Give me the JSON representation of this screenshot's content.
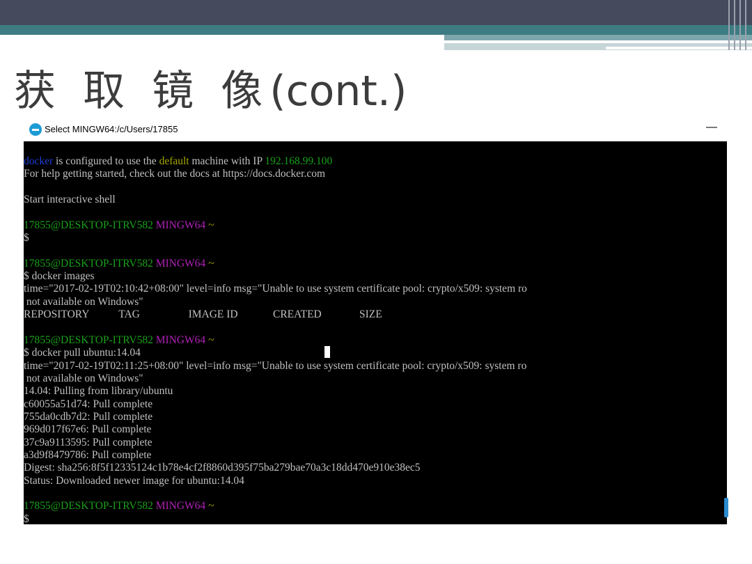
{
  "slide": {
    "title_cjk": "获 取 镜 像",
    "title_latin": "(cont.)"
  },
  "window": {
    "title": "Select MINGW64:/c/Users/17855",
    "minimize_glyph": "—"
  },
  "terminal": {
    "line1": {
      "a": "docker",
      "b": " is configured to use the ",
      "c": "default",
      "d": " machine with IP ",
      "e": "192.168.99.100"
    },
    "line2": "For help getting started, check out the docs at https://docs.docker.com",
    "line3": "",
    "line4": "Start interactive shell",
    "line5": "",
    "prompt_user": "17855@DESKTOP-ITRV582",
    "prompt_env": "MINGW64",
    "prompt_path": "~",
    "dollar": "$",
    "cmd_images": "$ docker images",
    "warn1": "time=\"2017-02-19T02:10:42+08:00\" level=info msg=\"Unable to use system certificate pool: crypto/x509: system ro",
    "warn_cont": " not available on Windows\"",
    "images_header": "REPOSITORY           TAG                  IMAGE ID             CREATED              SIZE",
    "cmd_pull": "$ docker pull ubuntu:14.04",
    "warn2": "time=\"2017-02-19T02:11:25+08:00\" level=info msg=\"Unable to use system certificate pool: crypto/x509: system ro",
    "pulling": "14.04: Pulling from library/ubuntu",
    "layers": [
      "c60055a51d74: Pull complete",
      "755da0cdb7d2: Pull complete",
      "969d017f67e6: Pull complete",
      "37c9a9113595: Pull complete",
      "a3d9f8479786: Pull complete"
    ],
    "digest": "Digest: sha256:8f5f12335124c1b78e4cf2f8860d395f75ba279bae70a3c18dd470e910e38ec5",
    "status": "Status: Downloaded newer image for ubuntu:14.04"
  },
  "colors": {
    "header_dark": "#454a5c",
    "header_teal": "#3d7c83",
    "prompt_green": "#19a019",
    "prompt_purple": "#b020b8",
    "prompt_yellow": "#a8a800",
    "docker_blue": "#1f3fd6"
  }
}
